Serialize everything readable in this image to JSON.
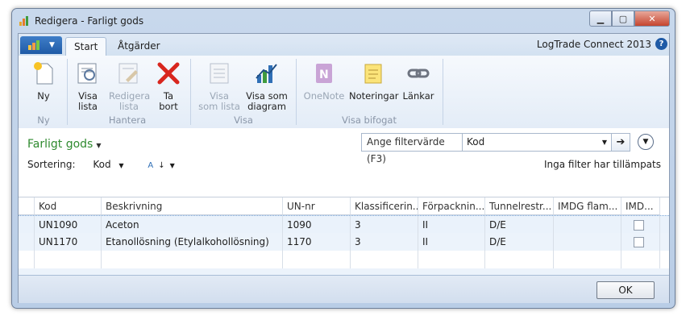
{
  "window": {
    "title": "Redigera - Farligt gods"
  },
  "ribbon": {
    "tabs": [
      {
        "label": "Start",
        "active": true
      },
      {
        "label": "Åtgärder",
        "active": false
      }
    ],
    "product": "LogTrade Connect 2013",
    "help": "?",
    "buttons": {
      "ny": "Ny",
      "visa_lista": "Visa\nlista",
      "redigera_lista": "Redigera\nlista",
      "ta_bort": "Ta\nbort",
      "visa_som_lista": "Visa\nsom lista",
      "visa_som_diagram": "Visa som\ndiagram",
      "onenote": "OneNote",
      "noteringar": "Noteringar",
      "lankar": "Länkar"
    },
    "groups": {
      "ny": "Ny",
      "hantera": "Hantera",
      "visa": "Visa",
      "visa_bifogat": "Visa bifogat"
    }
  },
  "page": {
    "title": "Farligt gods",
    "filter_label": "Ange filtervärde (F3)",
    "filter_field": "Kod",
    "sort_label": "Sortering:",
    "sort_field": "Kod",
    "no_filter": "Inga filter har tillämpats"
  },
  "grid": {
    "columns": [
      "Kod",
      "Beskrivning",
      "UN-nr",
      "Klassificerin...",
      "Förpacknin...",
      "Tunnelrestr...",
      "IMDG flam...",
      "IMD..."
    ],
    "rows": [
      [
        "UN1090",
        "Aceton",
        "1090",
        "3",
        "II",
        "D/E",
        "",
        ""
      ],
      [
        "UN1170",
        "Etanollösning (Etylalkohollösning)",
        "1170",
        "3",
        "II",
        "D/E",
        "",
        ""
      ]
    ]
  },
  "footer": {
    "ok": "OK"
  },
  "colors": {
    "accent": "#1f5aa6",
    "page_title": "#2f8a2f",
    "close": "#c5442e"
  },
  "icons": [
    "app-icon",
    "new-document-icon",
    "list-view-icon",
    "edit-list-icon",
    "delete-x-icon",
    "list-icon",
    "chart-icon",
    "onenote-icon",
    "notes-icon",
    "links-icon",
    "arrow-right-icon",
    "expand-chevron-icon",
    "sort-az-icon"
  ]
}
